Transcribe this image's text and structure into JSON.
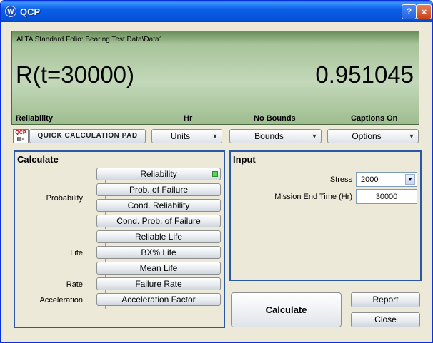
{
  "window": {
    "title": "QCP",
    "app_icon": "w-icon",
    "help_label": "?",
    "close_label": "×"
  },
  "display": {
    "folio": "ALTA Standard Folio: Bearing Test Data\\Data1",
    "expression": "R(t=30000)",
    "result": "0.951045",
    "captions": [
      "Reliability",
      "Hr",
      "No Bounds",
      "Captions On"
    ],
    "colors": {
      "panel_light": "#c3d8b9",
      "panel_dark": "#6a8f5a"
    }
  },
  "toolbar": {
    "logo_text": "QCP",
    "qcp_label": "Quick Calculation Pad",
    "units_label": "Units",
    "bounds_label": "Bounds",
    "options_label": "Options"
  },
  "calculate": {
    "title": "Calculate",
    "categories": [
      "Probability",
      "Life",
      "Rate",
      "Acceleration"
    ],
    "buttons": [
      "Reliability",
      "Prob. of Failure",
      "Cond. Reliability",
      "Cond. Prob. of Failure",
      "Reliable Life",
      "BX% Life",
      "Mean Life",
      "Failure Rate",
      "Acceleration Factor"
    ],
    "selected": "Reliability",
    "selected_color": "#5bd35b"
  },
  "input": {
    "title": "Input",
    "stress_label": "Stress",
    "stress_value": "2000",
    "mission_label": "Mission End Time (Hr)",
    "mission_value": "30000"
  },
  "actions": {
    "calculate": "Calculate",
    "report": "Report",
    "close": "Close"
  },
  "accent_color": "#2b57a7"
}
